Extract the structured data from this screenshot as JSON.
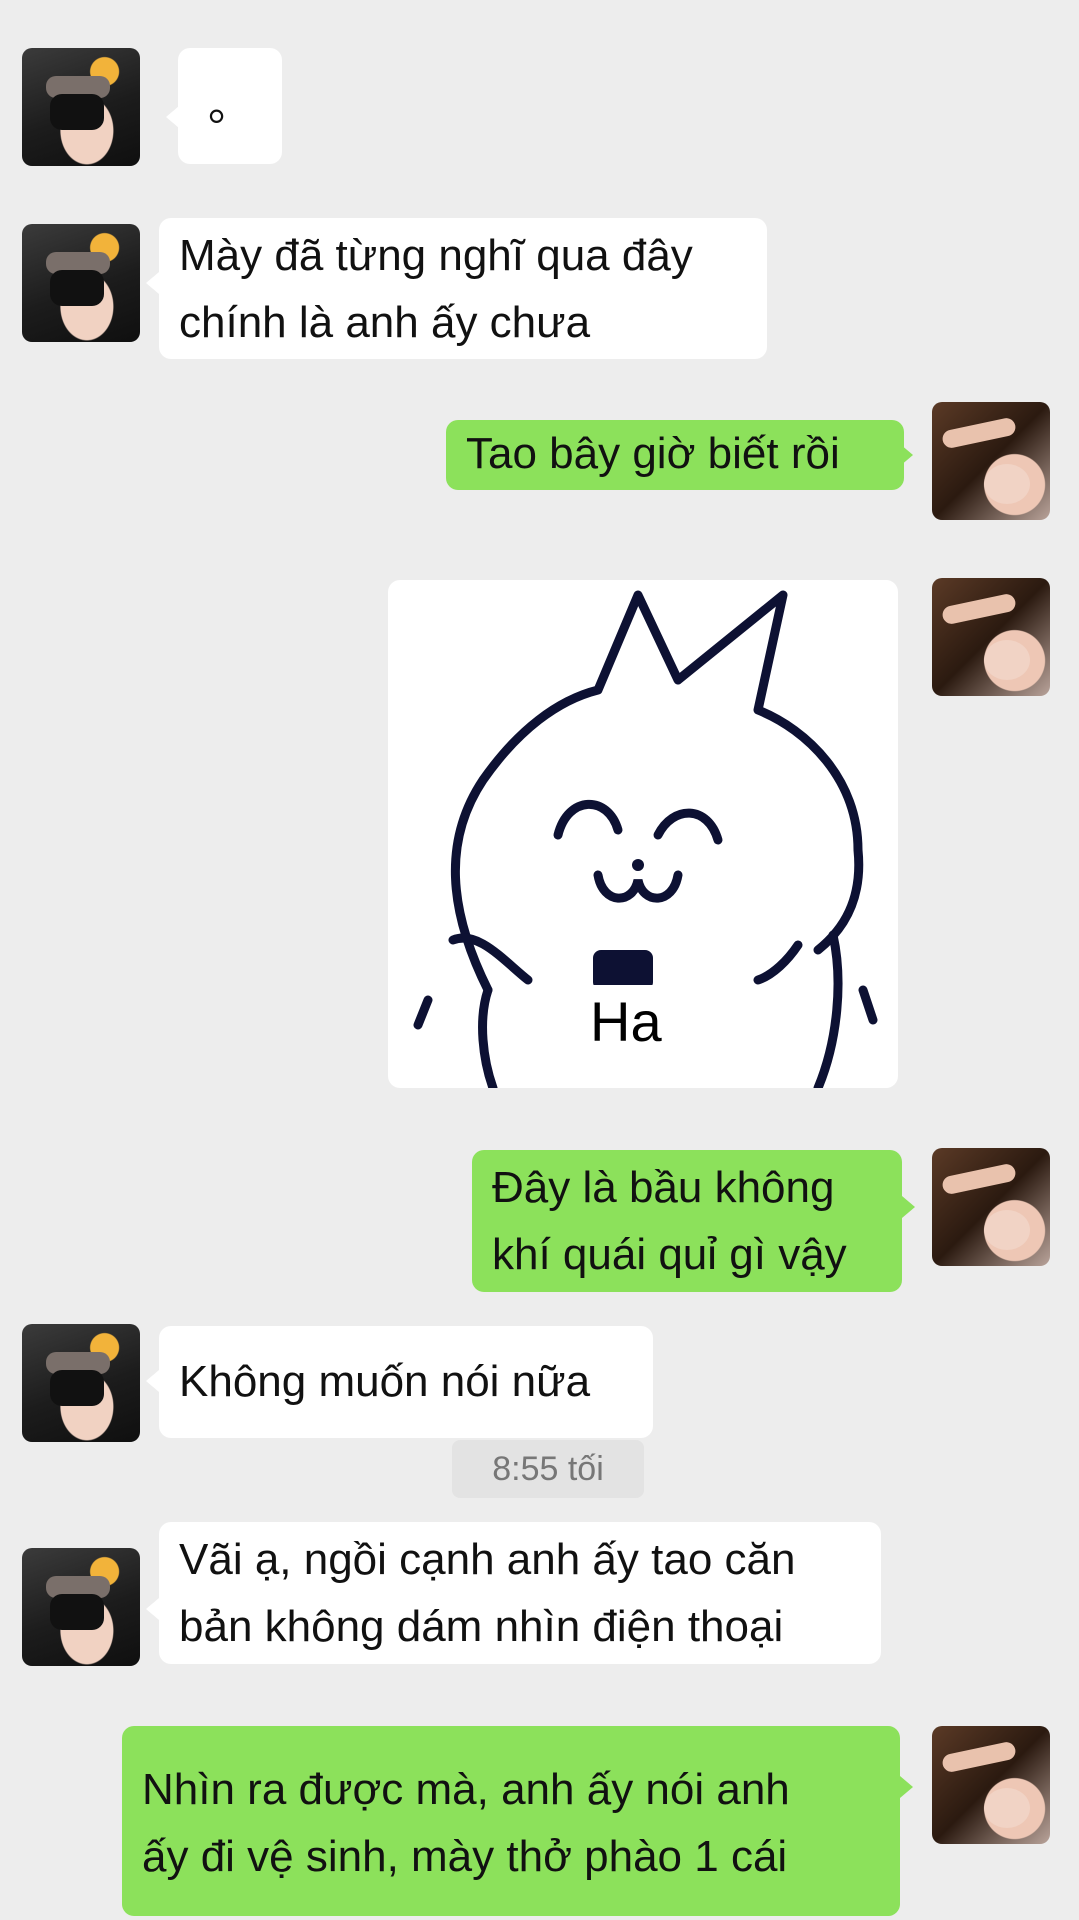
{
  "messages": [
    {
      "side": "left",
      "lines": [
        "。"
      ]
    },
    {
      "side": "left",
      "lines": [
        "Mày đã từng nghĩ qua đây",
        "chính là anh ấy chưa"
      ]
    },
    {
      "side": "right",
      "lines": [
        "Tao bây giờ biết rồi"
      ]
    },
    {
      "side": "right",
      "type": "sticker",
      "caption": "Ha"
    },
    {
      "side": "right",
      "lines": [
        "Đây là bầu không",
        "khí quái quỉ gì vậy"
      ]
    },
    {
      "side": "left",
      "lines": [
        "Không muốn nói nữa"
      ]
    },
    {
      "side": "left",
      "lines": [
        "Vãi ạ, ngồi cạnh anh ấy tao căn",
        "bản không dám nhìn điện thoại"
      ]
    },
    {
      "side": "right",
      "lines": [
        "Nhìn ra được mà, anh ấy nói anh",
        "ấy đi vệ sinh, mày thở phào 1 cái"
      ]
    }
  ],
  "timestamp": "8:55 tối",
  "colors": {
    "background": "#ededed",
    "sent_bubble": "#8ce15b",
    "received_bubble": "#ffffff"
  },
  "icons": {
    "sticker": "cat-sticker-icon",
    "avatar_left": "friend-avatar",
    "avatar_right": "self-avatar"
  }
}
